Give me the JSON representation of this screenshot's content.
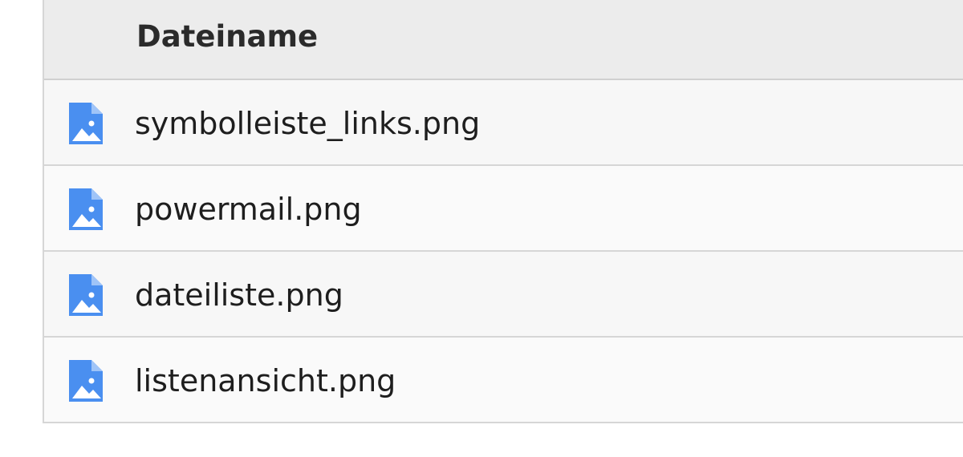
{
  "table": {
    "header": {
      "filename_label": "Dateiname"
    },
    "rows": [
      {
        "name": "symbolleiste_links.png",
        "icon": "image-file-icon"
      },
      {
        "name": "powermail.png",
        "icon": "image-file-icon"
      },
      {
        "name": "dateiliste.png",
        "icon": "image-file-icon"
      },
      {
        "name": "listenansicht.png",
        "icon": "image-file-icon"
      }
    ]
  },
  "colors": {
    "icon_blue": "#4a8ff0",
    "header_bg": "#ececec",
    "row_bg": "#f7f7f7",
    "border": "#d6d6d6"
  }
}
